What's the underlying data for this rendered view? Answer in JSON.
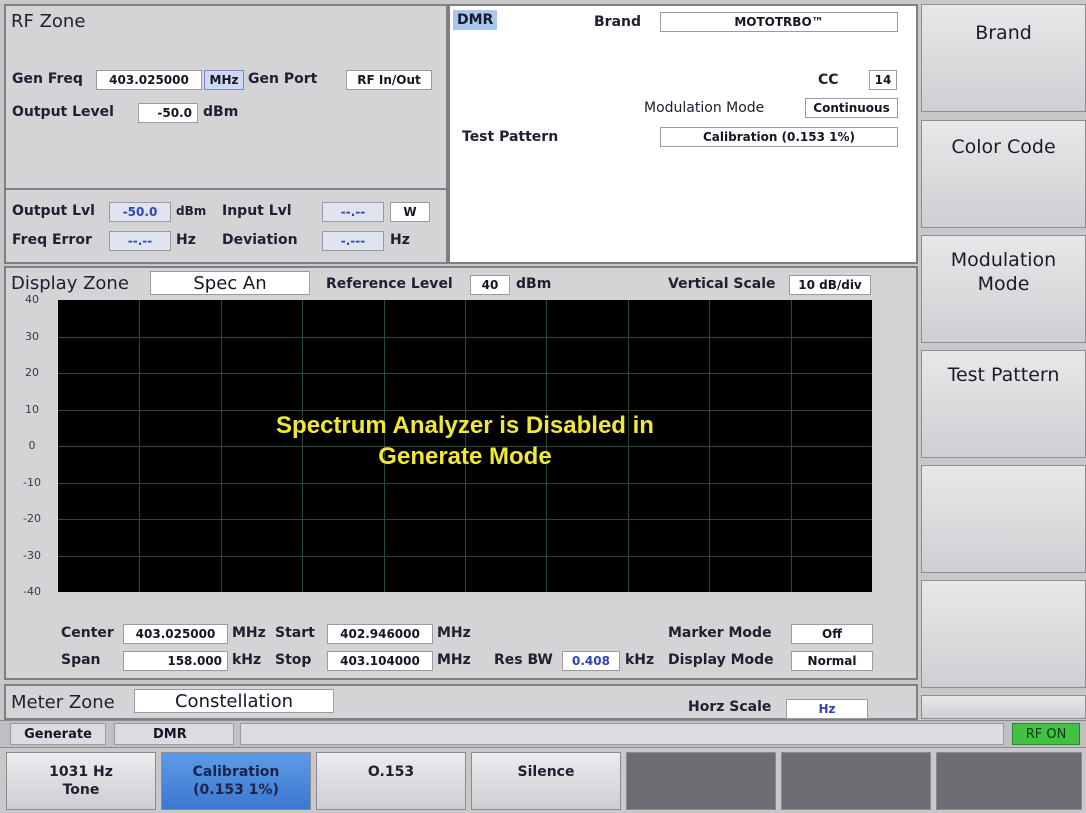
{
  "rf_zone": {
    "title": "RF Zone",
    "gen_freq_label": "Gen Freq",
    "gen_freq_value": "403.025000",
    "gen_freq_unit": "MHz",
    "gen_port_label": "Gen Port",
    "gen_port_value": "RF In/Out",
    "output_level_label": "Output Level",
    "output_level_value": "-50.0",
    "output_level_unit": "dBm",
    "output_lvl_label": "Output Lvl",
    "output_lvl_value": "-50.0",
    "output_lvl_unit": "dBm",
    "input_lvl_label": "Input Lvl",
    "input_lvl_value": "--.--",
    "input_lvl_unit": "W",
    "freq_error_label": "Freq Error",
    "freq_error_value": "--.--",
    "freq_error_unit": "Hz",
    "deviation_label": "Deviation",
    "deviation_value": "-.---",
    "deviation_unit": "Hz"
  },
  "dmr": {
    "title": "DMR",
    "brand_label": "Brand",
    "brand_value": "MOTOTRBO™",
    "cc_label": "CC",
    "cc_value": "14",
    "modulation_mode_label": "Modulation Mode",
    "modulation_mode_value": "Continuous",
    "test_pattern_label": "Test Pattern",
    "test_pattern_value": "Calibration (0.153 1%)"
  },
  "display_zone": {
    "title": "Display Zone",
    "mode": "Spec An",
    "reference_level_label": "Reference Level",
    "reference_level_value": "40",
    "reference_level_unit": "dBm",
    "vertical_scale_label": "Vertical Scale",
    "vertical_scale_value": "10 dB/div",
    "y_ticks": [
      "40",
      "30",
      "20",
      "10",
      "0",
      "-10",
      "-20",
      "-30",
      "-40"
    ],
    "message_line1": "Spectrum Analyzer is Disabled in",
    "message_line2": "Generate Mode",
    "center_label": "Center",
    "center_value": "403.025000",
    "center_unit": "MHz",
    "start_label": "Start",
    "start_value": "402.946000",
    "start_unit": "MHz",
    "span_label": "Span",
    "span_value": "158.000",
    "span_unit": "kHz",
    "stop_label": "Stop",
    "stop_value": "403.104000",
    "stop_unit": "MHz",
    "res_bw_label": "Res BW",
    "res_bw_value": "0.408",
    "res_bw_unit": "kHz",
    "marker_mode_label": "Marker Mode",
    "marker_mode_value": "Off",
    "display_mode_label": "Display Mode",
    "display_mode_value": "Normal"
  },
  "meter_zone": {
    "title": "Meter Zone",
    "mode": "Constellation",
    "horz_scale_label": "Horz Scale",
    "horz_scale_value": "Hz"
  },
  "status_bar": {
    "mode": "Generate",
    "protocol": "DMR",
    "rf_status": "RF ON"
  },
  "softkeys": {
    "brand": "Brand",
    "color_code": "Color Code",
    "modulation_mode_line1": "Modulation",
    "modulation_mode_line2": "Mode",
    "test_pattern": "Test Pattern"
  },
  "bottom_keys": {
    "tone_line1": "1031 Hz",
    "tone_line2": "Tone",
    "calibration_line1": "Calibration",
    "calibration_line2": "(0.153 1%)",
    "o153": "O.153",
    "silence": "Silence"
  },
  "colors": {
    "accent_active": "#3b78cf",
    "rf_on": "#44c044",
    "message": "#f0e838",
    "screen": "#000000"
  }
}
